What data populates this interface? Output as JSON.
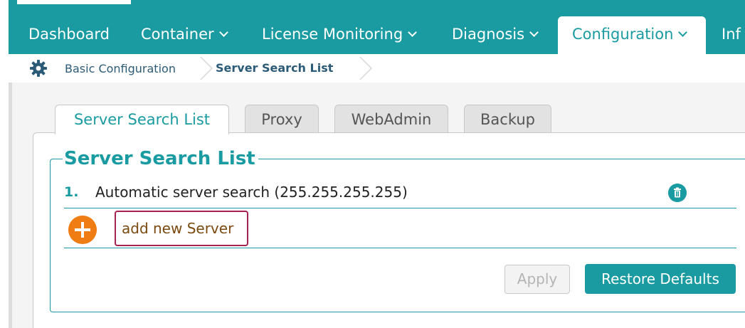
{
  "nav": {
    "items": [
      {
        "label": "Dashboard"
      },
      {
        "label": "Container"
      },
      {
        "label": "License Monitoring"
      },
      {
        "label": "Diagnosis"
      },
      {
        "label": "Configuration"
      },
      {
        "label": "Inf"
      }
    ],
    "active": "Configuration"
  },
  "breadcrumb": {
    "items": [
      {
        "label": "Basic Configuration"
      },
      {
        "label": "Server Search List"
      }
    ]
  },
  "tabs": [
    {
      "label": "Server Search List",
      "active": true
    },
    {
      "label": "Proxy",
      "active": false
    },
    {
      "label": "WebAdmin",
      "active": false
    },
    {
      "label": "Backup",
      "active": false
    }
  ],
  "section": {
    "title": "Server Search List"
  },
  "servers": [
    {
      "number": "1.",
      "name": "Automatic server search (255.255.255.255)"
    }
  ],
  "add_server": {
    "label": "add new Server"
  },
  "buttons": {
    "apply": "Apply",
    "restore": "Restore Defaults"
  },
  "colors": {
    "accent": "#1a9ba2",
    "add_button": "#f07d14",
    "input_border": "#a3224f"
  },
  "icons": {
    "breadcrumb": "gear-icon",
    "delete": "trash-icon",
    "add": "plus-icon"
  }
}
